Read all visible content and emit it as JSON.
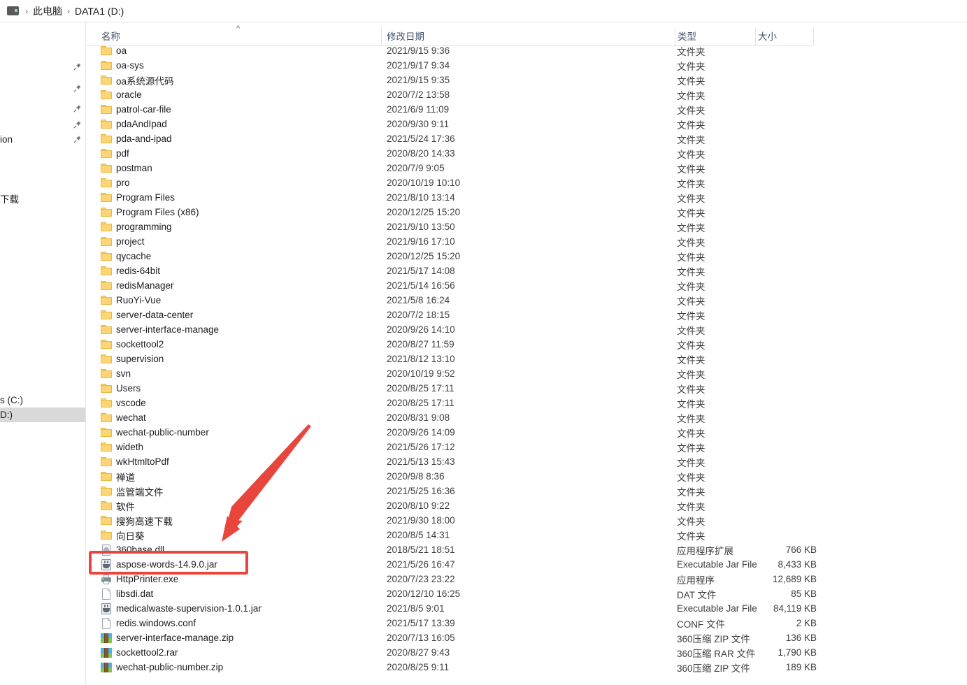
{
  "window": {
    "breadcrumb": {
      "computer_icon": "computer-icon",
      "separator": "›",
      "items": [
        "此电脑",
        "DATA1 (D:)"
      ]
    }
  },
  "nav_pane": {
    "items": [
      {
        "label": "",
        "pinned": true,
        "selected": false
      },
      {
        "label": "",
        "pinned": true,
        "selected": false
      },
      {
        "label": "",
        "pinned": true,
        "selected": false
      },
      {
        "label": "",
        "pinned": true,
        "selected": false
      },
      {
        "label": "ion",
        "pinned": true,
        "selected": false
      },
      {
        "label": "下载",
        "pinned": false,
        "selected": false
      },
      {
        "label": "s (C:)",
        "pinned": false,
        "selected": false
      },
      {
        "label": "D:)",
        "pinned": false,
        "selected": true
      }
    ]
  },
  "columns": {
    "name": "名称",
    "date_modified": "修改日期",
    "type": "类型",
    "size": "大小",
    "sort_indicator": "^"
  },
  "files": [
    {
      "name": "oa",
      "icon": "folder-icon",
      "date": "2021/9/15 9:36",
      "type": "文件夹",
      "size": ""
    },
    {
      "name": "oa-sys",
      "icon": "folder-icon",
      "date": "2021/9/17 9:34",
      "type": "文件夹",
      "size": ""
    },
    {
      "name": "oa系统源代码",
      "icon": "folder-icon",
      "date": "2021/9/15 9:35",
      "type": "文件夹",
      "size": ""
    },
    {
      "name": "oracle",
      "icon": "folder-icon",
      "date": "2020/7/2 13:58",
      "type": "文件夹",
      "size": ""
    },
    {
      "name": "patrol-car-file",
      "icon": "folder-icon",
      "date": "2021/6/9 11:09",
      "type": "文件夹",
      "size": ""
    },
    {
      "name": "pdaAndIpad",
      "icon": "folder-icon",
      "date": "2020/9/30 9:11",
      "type": "文件夹",
      "size": ""
    },
    {
      "name": "pda-and-ipad",
      "icon": "folder-icon",
      "date": "2021/5/24 17:36",
      "type": "文件夹",
      "size": ""
    },
    {
      "name": "pdf",
      "icon": "folder-icon",
      "date": "2020/8/20 14:33",
      "type": "文件夹",
      "size": ""
    },
    {
      "name": "postman",
      "icon": "folder-icon",
      "date": "2020/7/9 9:05",
      "type": "文件夹",
      "size": ""
    },
    {
      "name": "pro",
      "icon": "folder-icon",
      "date": "2020/10/19 10:10",
      "type": "文件夹",
      "size": ""
    },
    {
      "name": "Program Files",
      "icon": "folder-icon",
      "date": "2021/8/10 13:14",
      "type": "文件夹",
      "size": ""
    },
    {
      "name": "Program Files (x86)",
      "icon": "folder-icon",
      "date": "2020/12/25 15:20",
      "type": "文件夹",
      "size": ""
    },
    {
      "name": "programming",
      "icon": "folder-icon",
      "date": "2021/9/10 13:50",
      "type": "文件夹",
      "size": ""
    },
    {
      "name": "project",
      "icon": "folder-icon",
      "date": "2021/9/16 17:10",
      "type": "文件夹",
      "size": ""
    },
    {
      "name": "qycache",
      "icon": "folder-icon",
      "date": "2020/12/25 15:20",
      "type": "文件夹",
      "size": ""
    },
    {
      "name": "redis-64bit",
      "icon": "folder-icon",
      "date": "2021/5/17 14:08",
      "type": "文件夹",
      "size": ""
    },
    {
      "name": "redisManager",
      "icon": "folder-icon",
      "date": "2021/5/14 16:56",
      "type": "文件夹",
      "size": ""
    },
    {
      "name": "RuoYi-Vue",
      "icon": "folder-icon",
      "date": "2021/5/8 16:24",
      "type": "文件夹",
      "size": ""
    },
    {
      "name": "server-data-center",
      "icon": "folder-icon",
      "date": "2020/7/2 18:15",
      "type": "文件夹",
      "size": ""
    },
    {
      "name": "server-interface-manage",
      "icon": "folder-icon",
      "date": "2020/9/26 14:10",
      "type": "文件夹",
      "size": ""
    },
    {
      "name": "sockettool2",
      "icon": "folder-icon",
      "date": "2020/8/27 11:59",
      "type": "文件夹",
      "size": ""
    },
    {
      "name": "supervision",
      "icon": "folder-icon",
      "date": "2021/8/12 13:10",
      "type": "文件夹",
      "size": ""
    },
    {
      "name": "svn",
      "icon": "folder-icon",
      "date": "2020/10/19 9:52",
      "type": "文件夹",
      "size": ""
    },
    {
      "name": "Users",
      "icon": "folder-icon",
      "date": "2020/8/25 17:11",
      "type": "文件夹",
      "size": ""
    },
    {
      "name": "vscode",
      "icon": "folder-icon",
      "date": "2020/8/25 17:11",
      "type": "文件夹",
      "size": ""
    },
    {
      "name": "wechat",
      "icon": "folder-icon",
      "date": "2020/8/31 9:08",
      "type": "文件夹",
      "size": ""
    },
    {
      "name": "wechat-public-number",
      "icon": "folder-icon",
      "date": "2020/9/26 14:09",
      "type": "文件夹",
      "size": ""
    },
    {
      "name": "wideth",
      "icon": "folder-icon",
      "date": "2021/5/26 17:12",
      "type": "文件夹",
      "size": ""
    },
    {
      "name": "wkHtmltoPdf",
      "icon": "folder-icon",
      "date": "2021/5/13 15:43",
      "type": "文件夹",
      "size": ""
    },
    {
      "name": "禅道",
      "icon": "folder-icon",
      "date": "2020/9/8 8:36",
      "type": "文件夹",
      "size": ""
    },
    {
      "name": "监管端文件",
      "icon": "folder-icon",
      "date": "2021/5/25 16:36",
      "type": "文件夹",
      "size": ""
    },
    {
      "name": "软件",
      "icon": "folder-icon",
      "date": "2020/8/10 9:22",
      "type": "文件夹",
      "size": ""
    },
    {
      "name": "搜狗高速下载",
      "icon": "folder-icon",
      "date": "2021/9/30 18:00",
      "type": "文件夹",
      "size": ""
    },
    {
      "name": "向日葵",
      "icon": "folder-icon",
      "date": "2020/8/5 14:31",
      "type": "文件夹",
      "size": ""
    },
    {
      "name": "360base.dll",
      "icon": "dll-icon",
      "date": "2018/5/21 18:51",
      "type": "应用程序扩展",
      "size": "766 KB"
    },
    {
      "name": "aspose-words-14.9.0.jar",
      "icon": "jar-icon",
      "date": "2021/5/26 16:47",
      "type": "Executable Jar File",
      "size": "8,433 KB"
    },
    {
      "name": "HttpPrinter.exe",
      "icon": "exe-icon",
      "date": "2020/7/23 23:22",
      "type": "应用程序",
      "size": "12,689 KB"
    },
    {
      "name": "libsdi.dat",
      "icon": "file-icon",
      "date": "2020/12/10 16:25",
      "type": "DAT 文件",
      "size": "85 KB"
    },
    {
      "name": "medicalwaste-supervision-1.0.1.jar",
      "icon": "jar-icon",
      "date": "2021/8/5 9:01",
      "type": "Executable Jar File",
      "size": "84,119 KB"
    },
    {
      "name": "redis.windows.conf",
      "icon": "file-icon",
      "date": "2021/5/17 13:39",
      "type": "CONF 文件",
      "size": "2 KB"
    },
    {
      "name": "server-interface-manage.zip",
      "icon": "zip-icon",
      "date": "2020/7/13 16:05",
      "type": "360压缩 ZIP 文件",
      "size": "136 KB"
    },
    {
      "name": "sockettool2.rar",
      "icon": "zip-icon",
      "date": "2020/8/27 9:43",
      "type": "360压缩 RAR 文件",
      "size": "1,790 KB"
    },
    {
      "name": "wechat-public-number.zip",
      "icon": "zip-icon",
      "date": "2020/8/25 9:11",
      "type": "360压缩 ZIP 文件",
      "size": "189 KB"
    }
  ],
  "annotations": {
    "highlight_color": "#e8453c",
    "highlighted_file": "aspose-words-14.9.0.jar",
    "arrow": "red-arrow-pointing-to-highlighted-file"
  }
}
